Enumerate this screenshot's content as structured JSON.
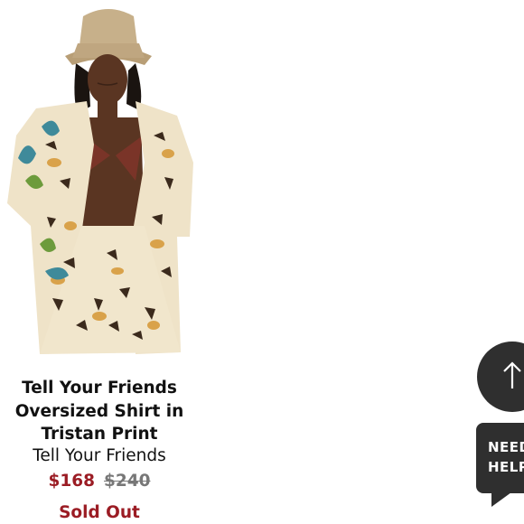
{
  "product": {
    "image_alt": "model wearing bucket hat and printed oversized shirt",
    "name_line1": "Tell Your Friends",
    "name_line2": "Oversized Shirt in",
    "name_line3": "Tristan Print",
    "brand": "Tell Your Friends",
    "sale_price": "$168",
    "original_price": "$240",
    "status": "Sold Out"
  },
  "widgets": {
    "back_to_top_icon": "arrow-up-icon",
    "help_line1": "NEED",
    "help_line2": "HELP"
  },
  "colors": {
    "sale": "#9b1c24",
    "widget_bg": "#2f2f2f"
  }
}
